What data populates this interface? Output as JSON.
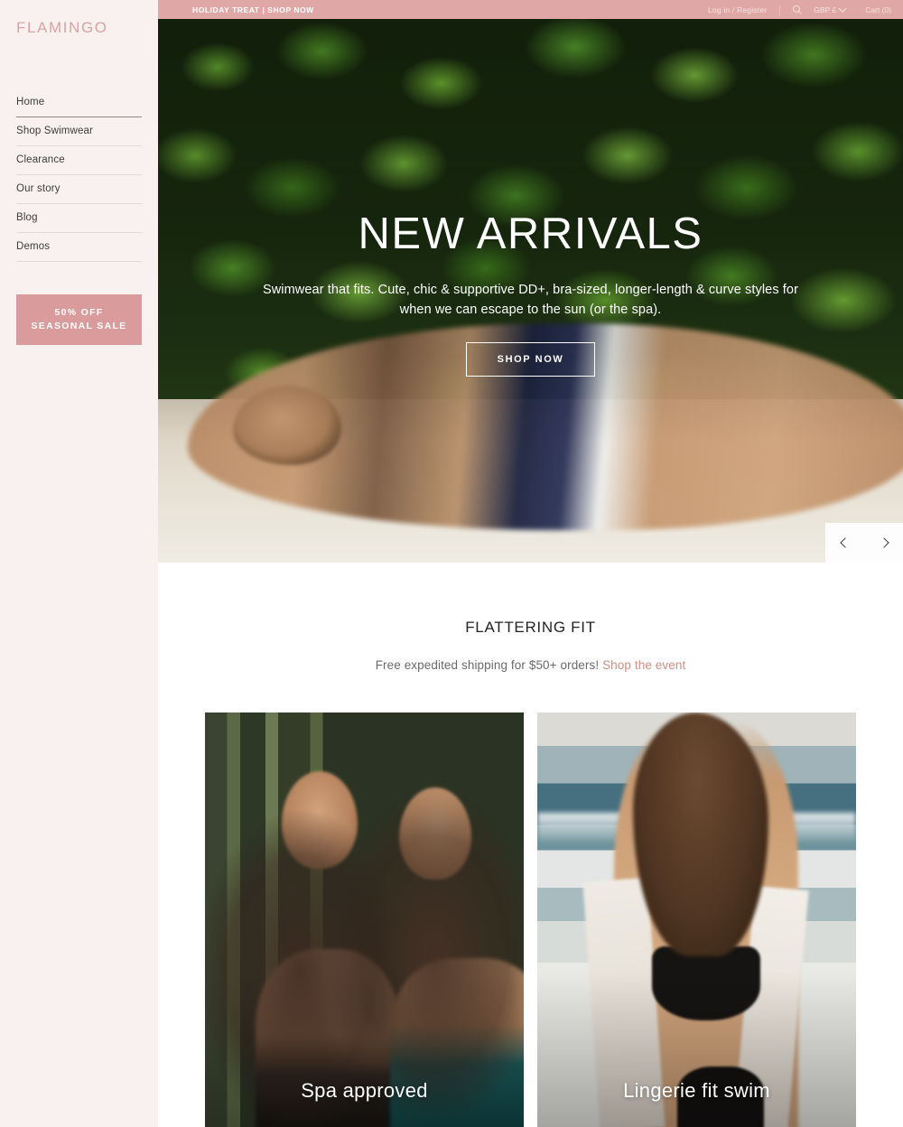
{
  "sidebar": {
    "logo": "FLAMINGO",
    "nav_items": [
      {
        "label": "Home",
        "active": true
      },
      {
        "label": "Shop Swimwear",
        "active": false
      },
      {
        "label": "Clearance",
        "active": false
      },
      {
        "label": "Our story",
        "active": false
      },
      {
        "label": "Blog",
        "active": false
      },
      {
        "label": "Demos",
        "active": false
      }
    ],
    "promo_button": {
      "line1": "50% OFF",
      "line2": "SEASONAL SALE",
      "background": "#d99b9b",
      "text_color": "#ffffff"
    },
    "background": "#f9f1ef",
    "logo_color": "#d8a3a1"
  },
  "topbar": {
    "announcement": "HOLIDAY TREAT | SHOP NOW",
    "account_link": "Log in / Register",
    "search_icon": "search-icon",
    "currency": "GBP £",
    "currency_caret": "chevron-down-icon",
    "cart": "Cart (0)",
    "background": "#dfa8a7"
  },
  "hero": {
    "title": "NEW ARRIVALS",
    "subtitle": "Swimwear that fits. Cute, chic & supportive DD+, bra-sized, longer-length & curve styles for when we can escape to the sun (or the spa).",
    "cta": "SHOP NOW",
    "carousel": {
      "prev_icon": "chevron-left-icon",
      "next_icon": "chevron-right-icon"
    }
  },
  "feature": {
    "title": "FLATTERING FIT",
    "subtitle": "Free expedited shipping for $50+ orders!",
    "link": "Shop the event",
    "link_color": "#cf8d82"
  },
  "cards": [
    {
      "caption": "Spa approved"
    },
    {
      "caption": "Lingerie fit swim"
    }
  ]
}
